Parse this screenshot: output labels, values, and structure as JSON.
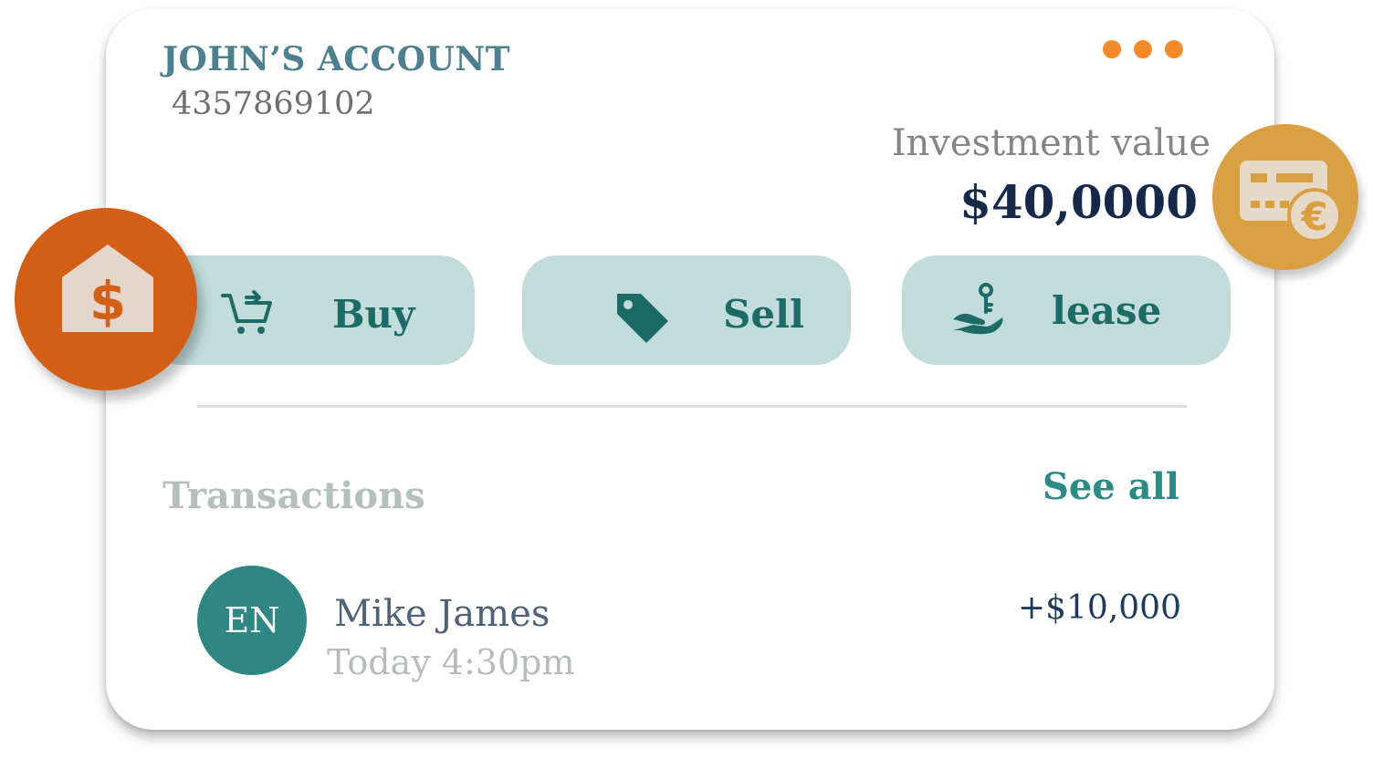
{
  "account": {
    "title": "JOHN’S ACCOUNT",
    "number": "4357869102"
  },
  "menu": {
    "icon": "more-dots-icon",
    "dot_color": "#f28a2c"
  },
  "investment": {
    "label": "Investment value",
    "value": "$40,0000"
  },
  "actions": [
    {
      "label": "Buy",
      "icon": "cart-add-icon"
    },
    {
      "label": "Sell",
      "icon": "price-tag-icon"
    },
    {
      "label": "lease",
      "icon": "hand-key-icon"
    }
  ],
  "badges": {
    "left": {
      "icon": "house-dollar-icon",
      "color": "#d35f17"
    },
    "right": {
      "icon": "card-euro-icon",
      "color": "#d9a043"
    }
  },
  "transactions": {
    "heading": "Transactions",
    "see_all": "See all",
    "items": [
      {
        "initials": "EN",
        "name": "Mike James",
        "time": "Today 4:30pm",
        "amount": "+$10,000"
      }
    ]
  },
  "colors": {
    "accent_teal": "#1d6b66",
    "button_bg": "#c2dcdc",
    "navy": "#17294b"
  }
}
